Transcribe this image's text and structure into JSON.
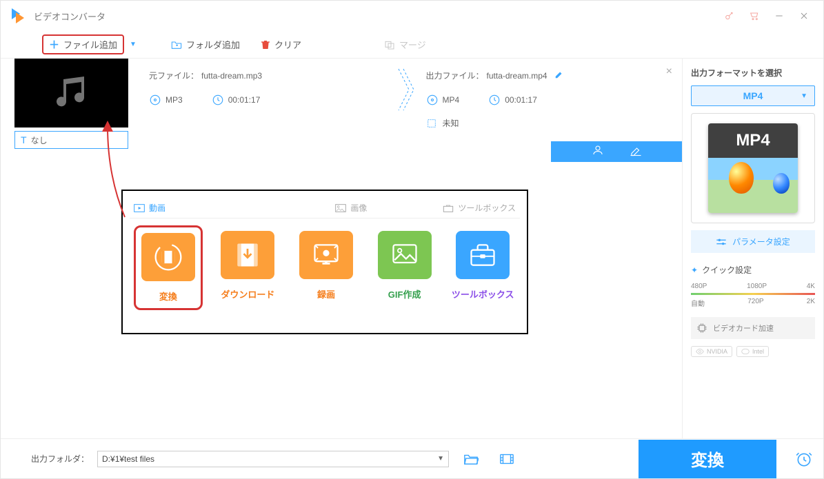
{
  "app": {
    "title": "ビデオコンバータ"
  },
  "toolbar": {
    "add_file": "ファイル追加",
    "add_folder": "フォルダ追加",
    "clear": "クリア",
    "merge": "マージ"
  },
  "thumb": {
    "title_label": "なし"
  },
  "source": {
    "label": "元ファイル：",
    "filename": "futta-dream.mp3",
    "format": "MP3",
    "duration": "00:01:17"
  },
  "output": {
    "label": "出力ファイル：",
    "filename": "futta-dream.mp4",
    "format": "MP4",
    "duration": "00:01:17",
    "size_label": "未知"
  },
  "popup": {
    "tab_video": "動画",
    "tab_image": "画像",
    "tab_toolbox": "ツールボックス",
    "cards": {
      "convert": "変換",
      "download": "ダウンロード",
      "record": "録画",
      "gif": "GIF作成",
      "toolbox": "ツールボックス"
    }
  },
  "right_panel": {
    "title": "出力フォーマットを選択",
    "format": "MP4",
    "format_badge": "MP4",
    "param_btn": "パラメータ設定",
    "quick_title": "クイック設定",
    "res_top": {
      "r1": "480P",
      "r2": "1080P",
      "r3": "4K"
    },
    "res_bot": {
      "r1": "自動",
      "r2": "720P",
      "r3": "2K"
    },
    "hw_accel": "ビデオカード加速",
    "gpu1": "NVIDIA",
    "gpu2": "Intel"
  },
  "bottom": {
    "label": "出力フォルダ：",
    "path": "D:¥1¥test files",
    "convert_btn": "変換"
  }
}
